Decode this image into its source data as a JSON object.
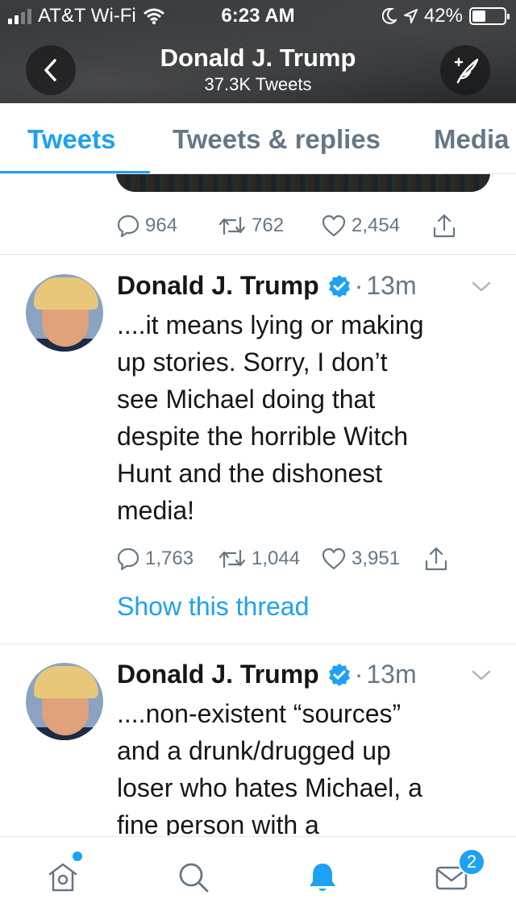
{
  "status_bar": {
    "carrier": "AT&T Wi-Fi",
    "time": "6:23 AM",
    "battery_percent": "42%",
    "battery_level": 0.42,
    "signal_bars_filled": 2,
    "signal_bars_total": 4,
    "icons": [
      "wifi-icon",
      "moon-icon",
      "location-arrow-icon",
      "battery-icon"
    ]
  },
  "header": {
    "title": "Donald J. Trump",
    "subtitle": "37.3K Tweets",
    "back_icon": "chevron-left-icon",
    "compose_icon": "compose-feather-icon"
  },
  "tabs": [
    {
      "label": "Tweets",
      "active": true
    },
    {
      "label": "Tweets & replies",
      "active": false
    },
    {
      "label": "Media",
      "active": false
    }
  ],
  "previous_tweet": {
    "replies": "964",
    "retweets": "762",
    "likes": "2,454"
  },
  "tweets": [
    {
      "author": "Donald J. Trump",
      "separator": "·",
      "time": "13m",
      "lines": [
        "....it means lying or making",
        "up stories. Sorry, I don’t",
        "see Michael doing that",
        "despite the horrible Witch",
        "Hunt and the dishonest",
        "media!"
      ],
      "replies": "1,763",
      "retweets": "1,044",
      "likes": "3,951",
      "show_thread": "Show this thread"
    },
    {
      "author": "Donald J. Trump",
      "separator": "·",
      "time": "13m",
      "lines": [
        "....non-existent “sources”",
        "and a drunk/drugged up",
        "loser who hates Michael, a",
        "fine person with a"
      ]
    }
  ],
  "bottom_nav": {
    "items": [
      "home-icon",
      "search-icon",
      "notifications-bell-icon",
      "messages-envelope-icon"
    ],
    "active": "notifications-bell-icon",
    "messages_badge": "2"
  },
  "colors": {
    "accent": "#1da1f2",
    "text": "#14171a",
    "secondary": "#657786",
    "divider": "#e1e8ed"
  }
}
